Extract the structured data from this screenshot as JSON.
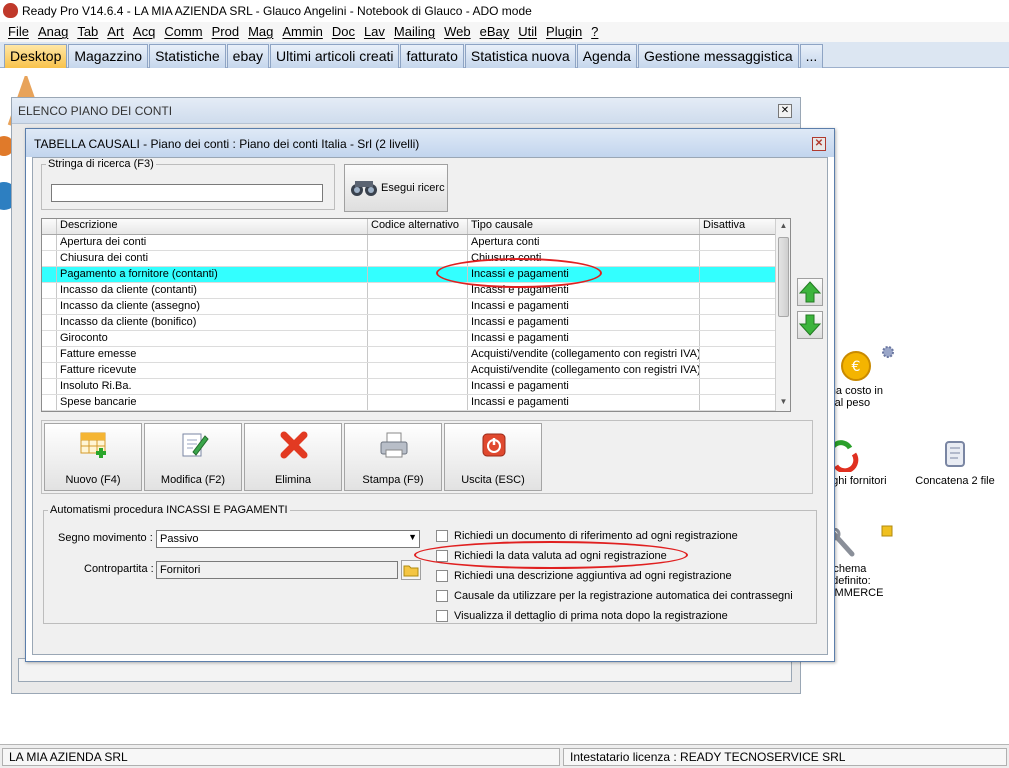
{
  "window": {
    "title": "Ready Pro V14.6.4 - LA MIA AZIENDA SRL - Glauco Angelini - Notebook di Glauco - ADO mode"
  },
  "menu": [
    "File",
    "Anag",
    "Tab",
    "Art",
    "Acq",
    "Comm",
    "Prod",
    "Mag",
    "Ammin",
    "Doc",
    "Lav",
    "Mailing",
    "Web",
    "eBay",
    "Util",
    "Plugin",
    "?"
  ],
  "tabs": [
    "Desktop",
    "Magazzino",
    "Statistiche",
    "ebay",
    "Ultimi articoli creati",
    "fatturato",
    "Statistica nuova",
    "Agenda",
    "Gestione messaggistica",
    "..."
  ],
  "desktop_icons": {
    "forma_costo": "orna costo in\nse al peso",
    "forma_costo_l1": "orna costo in",
    "forma_costo_l2": "se al peso",
    "fornitori": "oghi fornitori",
    "concatena": "Concatena 2 file",
    "schema_l1": "Schema",
    "schema_l2": "edefinito:",
    "schema_l3": "OMMERCE"
  },
  "outer_window": {
    "title": "ELENCO PIANO DEI CONTI"
  },
  "dialog": {
    "title": "TABELLA CAUSALI - Piano dei conti : Piano dei conti Italia - Srl (2 livelli)",
    "search_legend": "Stringa di ricerca (F3)",
    "search_value": "",
    "search_button": "Esegui ricerc",
    "columns": [
      "Descrizione",
      "Codice alternativo",
      "Tipo causale",
      "Disattiva"
    ],
    "rows": [
      {
        "desc": "Apertura dei conti",
        "code": "",
        "type": "Apertura conti"
      },
      {
        "desc": "Chiusura dei conti",
        "code": "",
        "type": "Chiusura conti"
      },
      {
        "desc": "Pagamento a fornitore (contanti)",
        "code": "",
        "type": "Incassi e pagamenti"
      },
      {
        "desc": "Incasso da cliente (contanti)",
        "code": "",
        "type": "Incassi e pagamenti"
      },
      {
        "desc": "Incasso da cliente (assegno)",
        "code": "",
        "type": "Incassi e pagamenti"
      },
      {
        "desc": "Incasso da cliente (bonifico)",
        "code": "",
        "type": "Incassi e pagamenti"
      },
      {
        "desc": "Giroconto",
        "code": "",
        "type": "Incassi e pagamenti"
      },
      {
        "desc": "Fatture emesse",
        "code": "",
        "type": "Acquisti/vendite (collegamento con registri IVA)"
      },
      {
        "desc": "Fatture ricevute",
        "code": "",
        "type": "Acquisti/vendite (collegamento con registri IVA)"
      },
      {
        "desc": "Insoluto Ri.Ba.",
        "code": "",
        "type": "Incassi e pagamenti"
      },
      {
        "desc": "Spese bancarie",
        "code": "",
        "type": "Incassi e pagamenti"
      }
    ],
    "actions": {
      "new": "Nuovo (F4)",
      "edit": "Modifica (F2)",
      "delete": "Elimina",
      "print": "Stampa (F9)",
      "exit": "Uscita (ESC)"
    },
    "auto_legend": "Automatismi procedura INCASSI E PAGAMENTI",
    "segno_label": "Segno movimento :",
    "segno_value": "Passivo",
    "contro_label": "Contropartita :",
    "contro_value": "Fornitori",
    "checks": [
      "Richiedi un documento di riferimento ad ogni registrazione",
      "Richiedi la data valuta ad ogni registrazione",
      "Richiedi una descrizione aggiuntiva ad ogni registrazione",
      "Causale da utilizzare per la registrazione automatica dei contrassegni",
      "Visualizza il dettaglio di prima nota dopo la registrazione"
    ]
  },
  "status": {
    "left": "LA MIA AZIENDA SRL",
    "right": "Intestatario licenza : READY TECNOSERVICE SRL"
  },
  "colors": {
    "selection": "#33ffff",
    "annotation": "#e02020",
    "active_tab": "#f8c24b"
  }
}
